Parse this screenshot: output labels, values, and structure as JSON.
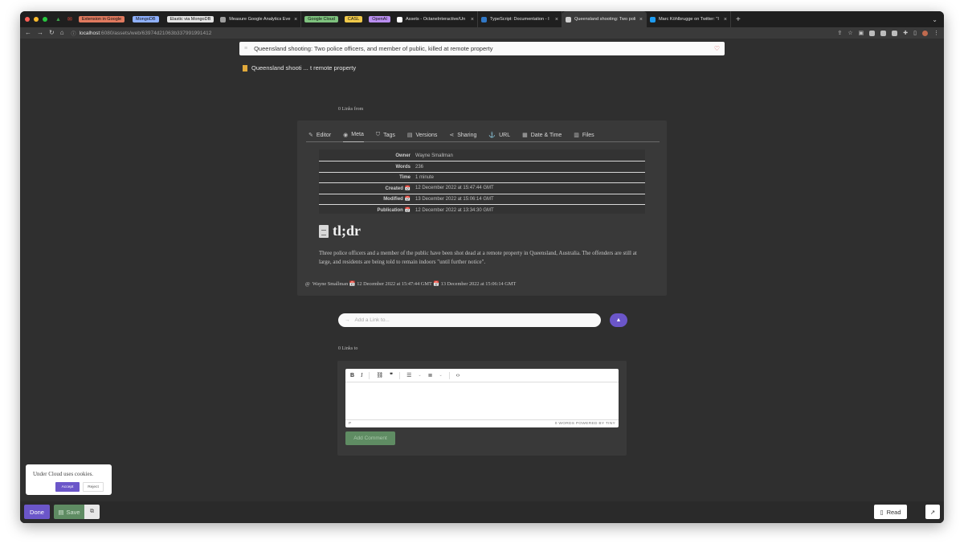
{
  "browser": {
    "pinned": [
      {
        "label": "Extension in Google",
        "color": "#e07a5f"
      },
      {
        "label": "MongoDB",
        "color": "#8fb1ff"
      },
      {
        "label": "Elastic via MongoDB",
        "color": "#e4e4e4"
      }
    ],
    "tabs": [
      {
        "label": "Measure Google Analytics Eve",
        "icon": "analytics-icon",
        "icon_color": "#9e9e9e"
      },
      {
        "label": "Google Cloud",
        "icon": "chip",
        "icon_color": "#7ec27e"
      },
      {
        "label": "CASL",
        "icon": "chip",
        "icon_color": "#f0c94a"
      },
      {
        "label": "OpenAI",
        "icon": "chip",
        "icon_color": "#b98ef0"
      },
      {
        "label": "Assets - OctaneInteractive/Un",
        "icon": "github-icon",
        "icon_color": "#ffffff"
      },
      {
        "label": "TypeScript: Documentation - I",
        "icon": "typescript-icon",
        "icon_color": "#3178c6"
      },
      {
        "label": "Queensland shooting: Two poli",
        "icon": "globe-icon",
        "icon_color": "#cfcfcf"
      },
      {
        "label": "Marc Köhlbrugge on Twitter: \"I",
        "icon": "twitter-icon",
        "icon_color": "#1d9bf0"
      }
    ],
    "url_host": "localhost",
    "url_path": ":6080/assets/web/63974d21063b337991991412"
  },
  "page": {
    "title": "Queensland shooting: Two police officers, and member of public, killed at remote property",
    "breadcrumb": "Queensland shooti ... t remote property",
    "links_from": "0 Links from",
    "tabs": [
      {
        "label": "Editor",
        "icon": "edit-icon"
      },
      {
        "label": "Meta",
        "icon": "eye-icon"
      },
      {
        "label": "Tags",
        "icon": "tags-icon"
      },
      {
        "label": "Versions",
        "icon": "versions-icon"
      },
      {
        "label": "Sharing",
        "icon": "share-icon"
      },
      {
        "label": "URL",
        "icon": "anchor-icon"
      },
      {
        "label": "Date & Time",
        "icon": "calendar-icon"
      },
      {
        "label": "Files",
        "icon": "file-icon"
      }
    ],
    "meta": [
      {
        "key": "Owner",
        "value": "Wayne Smallman"
      },
      {
        "key": "Words",
        "value": "236"
      },
      {
        "key": "Time",
        "value": "1 minute"
      },
      {
        "key": "Created 📅",
        "value": "12 December 2022 at 15:47:44 GMT"
      },
      {
        "key": "Modified 📅",
        "value": "13 December 2022 at 15:06:14 GMT"
      },
      {
        "key": "Publication 📅",
        "value": "12 December 2022 at 13:34:30 GMT"
      }
    ],
    "tldr_heading": "tl;dr",
    "summary": "Three police officers and a member of the public have been shot dead at a remote property in Queensland, Australia. The offenders are still at large, and residents are being told to remain indoors \"until further notice\".",
    "byline": "Wayne Smallman 📅 12 December 2022 at 15:47:44 GMT 📅 13 December 2022 at 15:06:14 GMT",
    "add_link_placeholder": "Add a Link to...",
    "links_to": "0 Links to",
    "editor_status_left": "P",
    "editor_status_right": "0 WORDS  POWERED BY TINY",
    "add_comment": "Add Comment",
    "cookie_msg": "Under Cloud uses cookies.",
    "cookie_accept": "Accept",
    "cookie_reject": "Reject",
    "done": "Done",
    "save": "Save",
    "read": "Read"
  }
}
